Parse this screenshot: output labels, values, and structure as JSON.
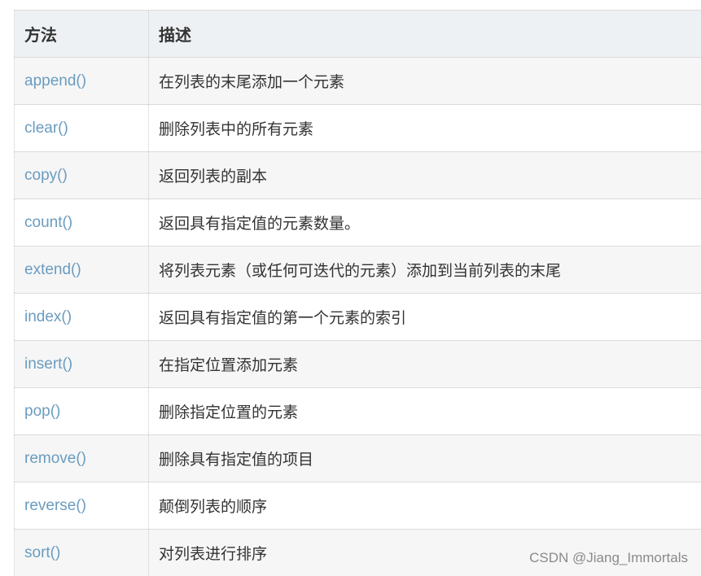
{
  "table": {
    "headers": [
      "方法",
      "描述"
    ],
    "rows": [
      {
        "method": "append()",
        "description": "在列表的末尾添加一个元素"
      },
      {
        "method": "clear()",
        "description": "删除列表中的所有元素"
      },
      {
        "method": "copy()",
        "description": "返回列表的副本"
      },
      {
        "method": "count()",
        "description": "返回具有指定值的元素数量。"
      },
      {
        "method": "extend()",
        "description": "将列表元素（或任何可迭代的元素）添加到当前列表的末尾"
      },
      {
        "method": "index()",
        "description": "返回具有指定值的第一个元素的索引"
      },
      {
        "method": "insert()",
        "description": "在指定位置添加元素"
      },
      {
        "method": "pop()",
        "description": "删除指定位置的元素"
      },
      {
        "method": "remove()",
        "description": "删除具有指定值的项目"
      },
      {
        "method": "reverse()",
        "description": "颠倒列表的顺序"
      },
      {
        "method": "sort()",
        "description": "对列表进行排序"
      }
    ]
  },
  "watermark": "CSDN @Jiang_Immortals",
  "colors": {
    "method_link": "#6a9cbf",
    "header_bg": "#eef1f4",
    "stripe_bg": "#f6f6f6",
    "text": "#333333"
  }
}
